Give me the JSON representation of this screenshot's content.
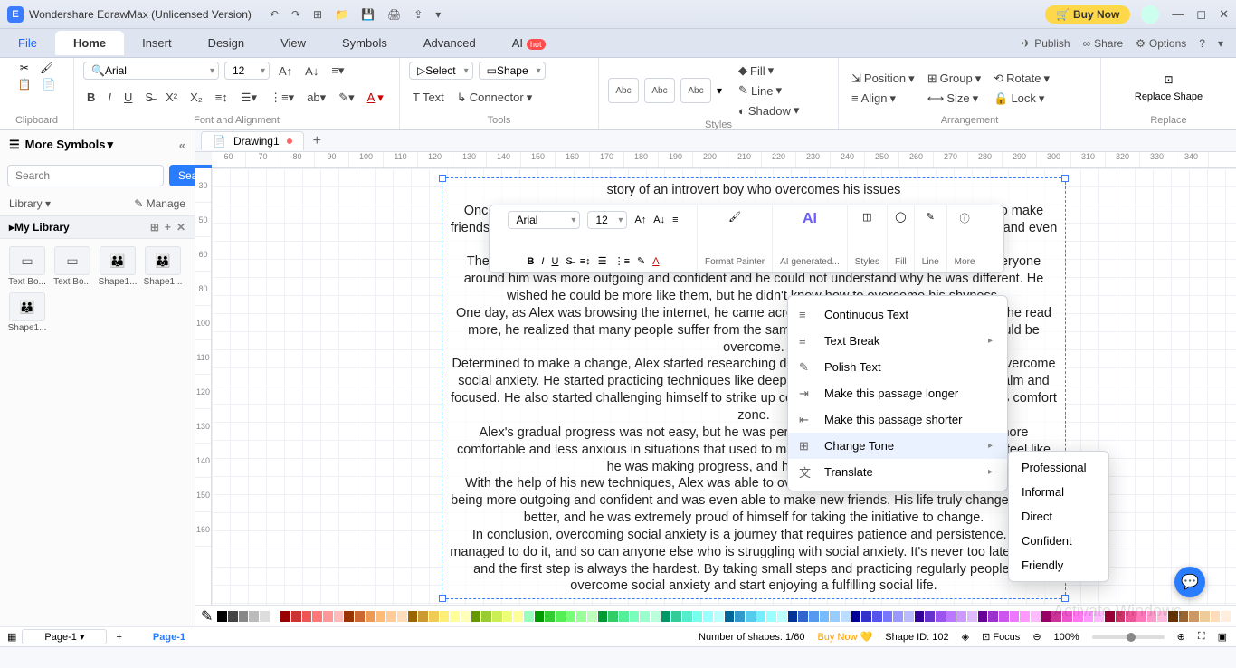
{
  "titlebar": {
    "app": "Wondershare EdrawMax (Unlicensed Version)",
    "buy": "Buy Now"
  },
  "menu": {
    "file": "File",
    "home": "Home",
    "insert": "Insert",
    "design": "Design",
    "view": "View",
    "symbols": "Symbols",
    "advanced": "Advanced",
    "ai": "AI",
    "hot": "hot",
    "publish": "Publish",
    "share": "Share",
    "options": "Options"
  },
  "ribbon": {
    "clipboard": "Clipboard",
    "font": "Font and Alignment",
    "tools": "Tools",
    "styles": "Styles",
    "arrangement": "Arrangement",
    "replace": "Replace",
    "font_name": "Arial",
    "font_size": "12",
    "select": "Select",
    "shape": "Shape",
    "text": "Text",
    "connector": "Connector",
    "fill": "Fill",
    "line": "Line",
    "shadow": "Shadow",
    "position": "Position",
    "align": "Align",
    "group": "Group",
    "size": "Size",
    "rotate": "Rotate",
    "lock": "Lock",
    "replace_shape": "Replace Shape",
    "abc": "Abc"
  },
  "side": {
    "more": "More Symbols",
    "search_ph": "Search",
    "search_btn": "Search",
    "library": "Library",
    "manage": "Manage",
    "mylib": "My Library",
    "thumbs": [
      "Text Bo...",
      "Text Bo...",
      "Shape1...",
      "Shape1...",
      "Shape1..."
    ]
  },
  "doc": {
    "tab": "Drawing1"
  },
  "ruler_h": [
    "60",
    "70",
    "80",
    "90",
    "100",
    "110",
    "120",
    "130",
    "140",
    "150",
    "160",
    "170",
    "180",
    "190",
    "200",
    "210",
    "220",
    "230",
    "240",
    "250",
    "260",
    "270",
    "280",
    "290",
    "300",
    "310",
    "320",
    "330",
    "340"
  ],
  "ruler_v": [
    "30",
    "50",
    "60",
    "80",
    "100",
    "110",
    "120",
    "130",
    "140",
    "150",
    "160"
  ],
  "story": {
    "title": "story of an introvert boy who overcomes his issues",
    "p1": "Once upon a time there was an introverted boy named Alex. He had always found it difficult to make friends and connect with others. He was shy and reserved which often made him feel excluded and even lonely.",
    "p2": "The older he grew, the more he became frustrated with his introverted nature. He felt that everyone around him was more outgoing and confident and he could not understand why he was different. He wished he could be more like them, but he didn't know how to overcome his shyness.",
    "p3": "One day, as Alex was browsing the internet, he came across an article about social anxiety. As he read more, he realized that many people suffer from the same issues he did and learned that it could be overcome.",
    "p4": "Determined to make a change, Alex started researching different techniques and strategies to overcome social anxiety. He started practicing techniques like deep breathing which helped him to stay calm and focused. He also started challenging himself to strike up conversations and put himself out of his comfort zone.",
    "p5": "Alex's gradual progress was not easy, but he was persistent. Over time he started feeling more comfortable and less anxious in situations that used to make him nervous. He started to finally feel like he was making progress, and his confidence grew.",
    "p6": "With the help of his new techniques, Alex was able to overcome his social anxiety. He found himself being more outgoing and confident and was even able to make new friends. His life truly changed for the better, and he was extremely proud of himself for taking the initiative to change.",
    "p7": "In conclusion, overcoming social anxiety is a journey that requires patience and persistence. Alex managed to do it, and so can anyone else who is struggling with social anxiety. It's never too late to start, and the first step is always the hardest. By taking small steps and practicing regularly people can overcome social anxiety and start enjoying a fulfilling social life."
  },
  "float": {
    "font": "Arial",
    "size": "12",
    "fp": "Format Painter",
    "ai": "AI generated...",
    "styles": "Styles",
    "fill": "Fill",
    "line": "Line",
    "more": "More"
  },
  "ctx": {
    "cont": "Continuous Text",
    "tb": "Text Break",
    "polish": "Polish Text",
    "longer": "Make this passage longer",
    "shorter": "Make this passage shorter",
    "tone": "Change Tone",
    "translate": "Translate"
  },
  "tones": [
    "Professional",
    "Informal",
    "Direct",
    "Confident",
    "Friendly"
  ],
  "status": {
    "page": "Page-1",
    "pagetab": "Page-1",
    "shapes": "Number of shapes: 1/60",
    "buy": "Buy Now",
    "shapeid": "Shape ID: 102",
    "focus": "Focus",
    "zoom": "100%"
  },
  "watermark": "Activate Windows",
  "palette": [
    "#000",
    "#444",
    "#888",
    "#bbb",
    "#ddd",
    "#fff",
    "#900",
    "#c33",
    "#e55",
    "#f77",
    "#f99",
    "#fbb",
    "#930",
    "#c63",
    "#e95",
    "#fb7",
    "#fc9",
    "#fdb",
    "#960",
    "#c93",
    "#ec5",
    "#fe7",
    "#ff9",
    "#ffb",
    "#690",
    "#9c3",
    "#ce5",
    "#ef7",
    "#ff9",
    "#9fb",
    "#090",
    "#3c3",
    "#5e5",
    "#7f7",
    "#9f9",
    "#bfb",
    "#093",
    "#3c6",
    "#5e9",
    "#7fb",
    "#9fc",
    "#bfd",
    "#096",
    "#3c9",
    "#5ec",
    "#7fe",
    "#9ff",
    "#bff",
    "#069",
    "#39c",
    "#5ce",
    "#7ef",
    "#9ff",
    "#bff",
    "#039",
    "#36c",
    "#59e",
    "#7bf",
    "#9cf",
    "#bdf",
    "#009",
    "#33c",
    "#55e",
    "#77f",
    "#99f",
    "#bbf",
    "#309",
    "#63c",
    "#95e",
    "#b7f",
    "#c9f",
    "#dbf",
    "#609",
    "#93c",
    "#c5e",
    "#e7f",
    "#f9f",
    "#fbf",
    "#906",
    "#c39",
    "#e5c",
    "#f7e",
    "#f9f",
    "#fbf",
    "#903",
    "#c36",
    "#e59",
    "#f7b",
    "#f9c",
    "#fbd",
    "#630",
    "#963",
    "#c96",
    "#ec9",
    "#fdb",
    "#fed"
  ]
}
